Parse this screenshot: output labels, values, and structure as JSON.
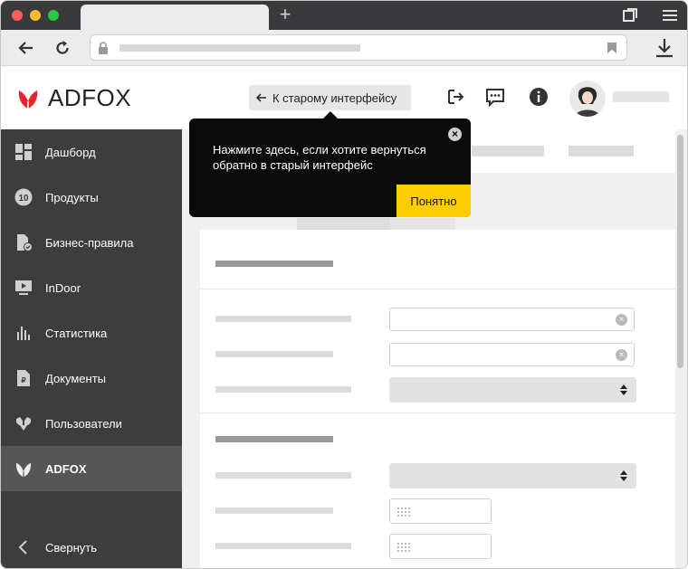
{
  "header": {
    "logo_text": "ADFOX",
    "old_interface_label": "К старому интерфейсу"
  },
  "sidebar": {
    "items": [
      {
        "label": "Дашборд",
        "icon": "dashboard-icon"
      },
      {
        "label": "Продукты",
        "icon": "products-10-icon"
      },
      {
        "label": "Бизнес-правила",
        "icon": "business-rules-icon"
      },
      {
        "label": "InDoor",
        "icon": "indoor-icon"
      },
      {
        "label": "Статистика",
        "icon": "statistics-icon"
      },
      {
        "label": "Документы",
        "icon": "documents-icon"
      },
      {
        "label": "Пользователи",
        "icon": "users-icon"
      },
      {
        "label": "ADFOX",
        "icon": "adfox-leaf-icon"
      }
    ],
    "collapse_label": "Свернуть"
  },
  "tooltip": {
    "text": "Нажмите здесь, если хотите вернуться обратно в старый интерфейс",
    "ok_label": "Понятно",
    "close_symbol": "×"
  },
  "form": {
    "clear_symbol": "×"
  },
  "colors": {
    "accent": "#ffcc00",
    "sidebar_bg": "#3d3d3d",
    "sidebar_active": "#565656",
    "logo_red": "#e4262c"
  }
}
